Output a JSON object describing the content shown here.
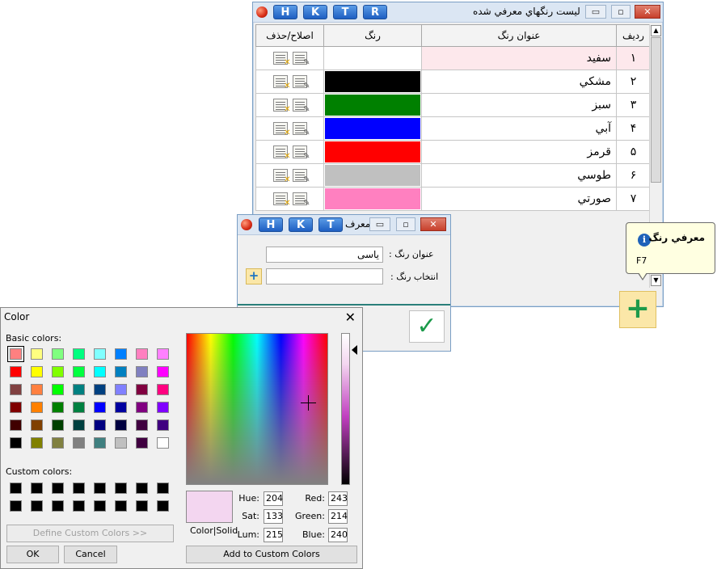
{
  "list_window": {
    "title": "ليست رنگهاي معرفي شده",
    "hotkeys": [
      "H",
      "K",
      "T",
      "R"
    ],
    "columns": {
      "row": "رديف",
      "name": "عنوان رنگ",
      "color": "رنگ",
      "actions": "اصلاح/حذف"
    },
    "rows": [
      {
        "num": "۱",
        "name": "سفيد",
        "color": "#ffffff"
      },
      {
        "num": "۲",
        "name": "مشكي",
        "color": "#000000"
      },
      {
        "num": "۳",
        "name": "سبز",
        "color": "#008000"
      },
      {
        "num": "۴",
        "name": "آبي",
        "color": "#0000ff"
      },
      {
        "num": "۵",
        "name": "قرمز",
        "color": "#ff0000"
      },
      {
        "num": "۶",
        "name": "طوسي",
        "color": "#c0c0c0"
      },
      {
        "num": "۷",
        "name": "صورتي",
        "color": "#ff80c0"
      }
    ],
    "selected_row_highlight": "#fde8ec"
  },
  "tooltip": {
    "title": "معرفي رنگ",
    "shortcut": "F7"
  },
  "define_window": {
    "title": "معرف",
    "hotkeys": [
      "H",
      "K",
      "T"
    ],
    "name_label": "عنوان رنگ :",
    "name_value": "ياسی",
    "pick_label": "انتخاب رنگ :",
    "pick_value": ""
  },
  "color_dialog": {
    "title": "Color",
    "basic_label": "Basic colors:",
    "custom_label": "Custom colors:",
    "basic_colors": [
      "#ff8080",
      "#ffff80",
      "#80ff80",
      "#00ff80",
      "#80ffff",
      "#0080ff",
      "#ff80c0",
      "#ff80ff",
      "#ff0000",
      "#ffff00",
      "#80ff00",
      "#00ff40",
      "#00ffff",
      "#0080c0",
      "#8080c0",
      "#ff00ff",
      "#804040",
      "#ff8040",
      "#00ff00",
      "#008080",
      "#004080",
      "#8080ff",
      "#800040",
      "#ff0080",
      "#800000",
      "#ff8000",
      "#008000",
      "#008040",
      "#0000ff",
      "#0000a0",
      "#800080",
      "#8000ff",
      "#400000",
      "#804000",
      "#004000",
      "#004040",
      "#000080",
      "#000040",
      "#400040",
      "#400080",
      "#000000",
      "#808000",
      "#808040",
      "#808080",
      "#408080",
      "#c0c0c0",
      "#400040",
      "#ffffff"
    ],
    "custom_colors": [
      "#000000",
      "#000000",
      "#000000",
      "#000000",
      "#000000",
      "#000000",
      "#000000",
      "#000000",
      "#000000",
      "#000000",
      "#000000",
      "#000000",
      "#000000",
      "#000000",
      "#000000",
      "#000000"
    ],
    "define_custom_label": "Define Custom Colors >>",
    "ok_label": "OK",
    "cancel_label": "Cancel",
    "add_custom_label": "Add to Custom Colors",
    "color_solid_label": "Color|Solid",
    "preview_color": "#f3d6f0",
    "hue_label": "Hue:",
    "hue": "204",
    "sat_label": "Sat:",
    "sat": "133",
    "lum_label": "Lum:",
    "lum": "215",
    "red_label": "Red:",
    "red": "243",
    "green_label": "Green:",
    "green": "214",
    "blue_label": "Blue:",
    "blue": "240"
  }
}
